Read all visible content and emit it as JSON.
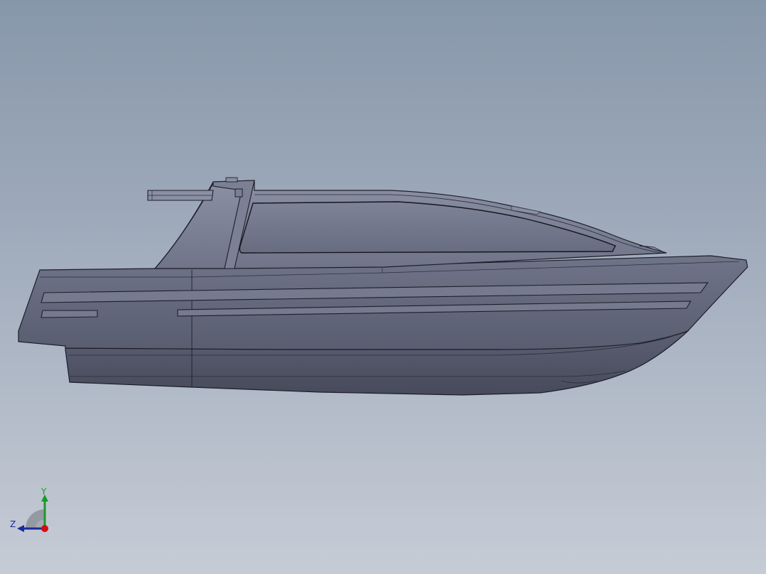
{
  "view": {
    "background_top": "#8797aa",
    "background_bottom": "#c6ccd6",
    "model_name": "boat"
  },
  "triad": {
    "y_label": "Y",
    "z_label": "Z",
    "y_color": "#1a9a2a",
    "z_color": "#1a2a9a",
    "x_color": "#d01010"
  }
}
